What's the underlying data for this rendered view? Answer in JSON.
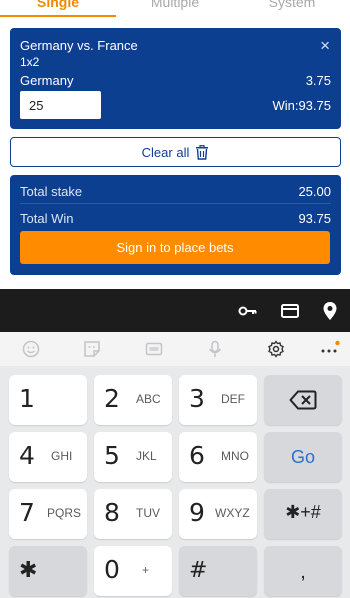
{
  "tabs": [
    "Single",
    "Multiple",
    "System"
  ],
  "bet": {
    "match": "Germany vs. France",
    "market": "1x2",
    "selection": "Germany",
    "odds": "3.75",
    "stake_value": "25",
    "win_text": "Win:93.75",
    "close_glyph": "×"
  },
  "clear_all_label": "Clear all",
  "summary": {
    "total_stake_label": "Total stake",
    "total_stake_value": "25.00",
    "total_win_label": "Total Win",
    "total_win_value": "93.75",
    "signin_label": "Sign in to place bets"
  },
  "keyboard": {
    "keys": [
      {
        "num": "1",
        "letters": ""
      },
      {
        "num": "2",
        "letters": "ABC"
      },
      {
        "num": "3",
        "letters": "DEF"
      },
      {
        "num": "4",
        "letters": "GHI"
      },
      {
        "num": "5",
        "letters": "JKL"
      },
      {
        "num": "6",
        "letters": "MNO"
      },
      {
        "num": "7",
        "letters": "PQRS"
      },
      {
        "num": "8",
        "letters": "TUV"
      },
      {
        "num": "9",
        "letters": "WXYZ"
      },
      {
        "num": "0",
        "letters": "+"
      }
    ],
    "go_label": "Go",
    "symbols_label": "✱+#",
    "star_label": "✱",
    "hash_label": "#",
    "comma_label": ",",
    "backspace_icon": "backspace-icon"
  },
  "colors": {
    "brand_blue": "#0d3f91",
    "accent_orange": "#ff8c00",
    "keyboard_bg": "#e8e9eb"
  }
}
